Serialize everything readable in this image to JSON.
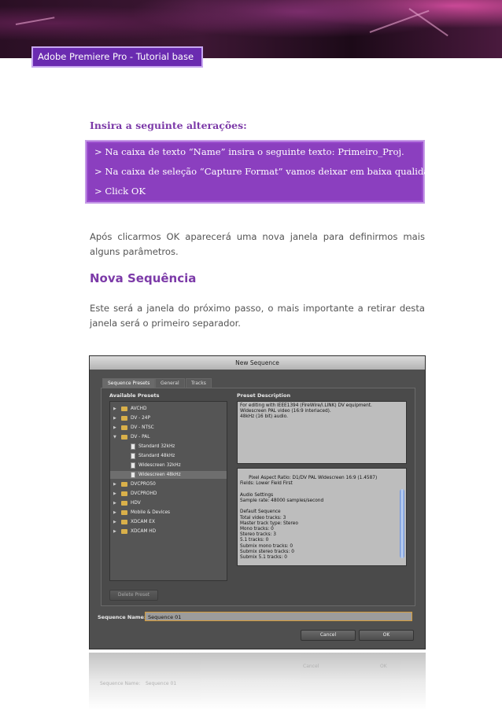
{
  "header": {
    "tag": "Adobe Premiere Pro - Tutorial base 1"
  },
  "instructions": {
    "title": "Insira a seguinte alterações:",
    "lines": [
      "> Na caixa de texto “Name” insira o seguinte texto: Primeiro_Proj.",
      "> Na caixa de seleção “Capture Format” vamos deixar em baixa qualidade.",
      "> Click OK"
    ]
  },
  "paragraph1": "Após clicarmos OK aparecerá uma nova janela para definirmos mais alguns parâmetros.",
  "section_title": "Nova Sequência",
  "paragraph2": "Este será a janela do próximo passo, o mais importante a retirar desta janela será o primeiro separador.",
  "dialog": {
    "title": "New Sequence",
    "tabs": [
      "Sequence Presets",
      "General",
      "Tracks"
    ],
    "available_presets_label": "Available Presets",
    "preset_description_label": "Preset Description",
    "presets": [
      {
        "label": "AVCHD",
        "kind": "folder",
        "level": 0
      },
      {
        "label": "DV - 24P",
        "kind": "folder",
        "level": 0
      },
      {
        "label": "DV - NTSC",
        "kind": "folder",
        "level": 0
      },
      {
        "label": "DV - PAL",
        "kind": "folder",
        "level": 0,
        "open": true
      },
      {
        "label": "Standard 32kHz",
        "kind": "file",
        "level": 1
      },
      {
        "label": "Standard 48kHz",
        "kind": "file",
        "level": 1
      },
      {
        "label": "Widescreen 32kHz",
        "kind": "file",
        "level": 1
      },
      {
        "label": "Widescreen 48kHz",
        "kind": "file",
        "level": 1,
        "selected": true
      },
      {
        "label": "DVCPRO50",
        "kind": "folder",
        "level": 0
      },
      {
        "label": "DVCPROHD",
        "kind": "folder",
        "level": 0
      },
      {
        "label": "HDV",
        "kind": "folder",
        "level": 0
      },
      {
        "label": "Mobile & Devices",
        "kind": "folder",
        "level": 0
      },
      {
        "label": "XDCAM EX",
        "kind": "folder",
        "level": 0
      },
      {
        "label": "XDCAM HD",
        "kind": "folder",
        "level": 0
      }
    ],
    "description_top": "For editing with IEEE1394 (FireWire/i.LINK) DV equipment.\nWidescreen PAL video (16:9 interlaced).\n48kHz (16 bit) audio.",
    "description_bottom": "Pixel Aspect Ratio: D1/DV PAL Widescreen 16:9 (1.4587)\nFields: Lower Field First\n\nAudio Settings\nSample rate: 48000 samples/second\n\nDefault Sequence\nTotal video tracks: 3\nMaster track type: Stereo\nMono tracks: 0\nStereo tracks: 3\n5.1 tracks: 0\nSubmix mono tracks: 0\nSubmix stereo tracks: 0\nSubmix 5.1 tracks: 0",
    "delete_preset": "Delete Preset",
    "sequence_name_label": "Sequence Name:",
    "sequence_name_value": "Sequence 01",
    "cancel": "Cancel",
    "ok": "OK"
  }
}
